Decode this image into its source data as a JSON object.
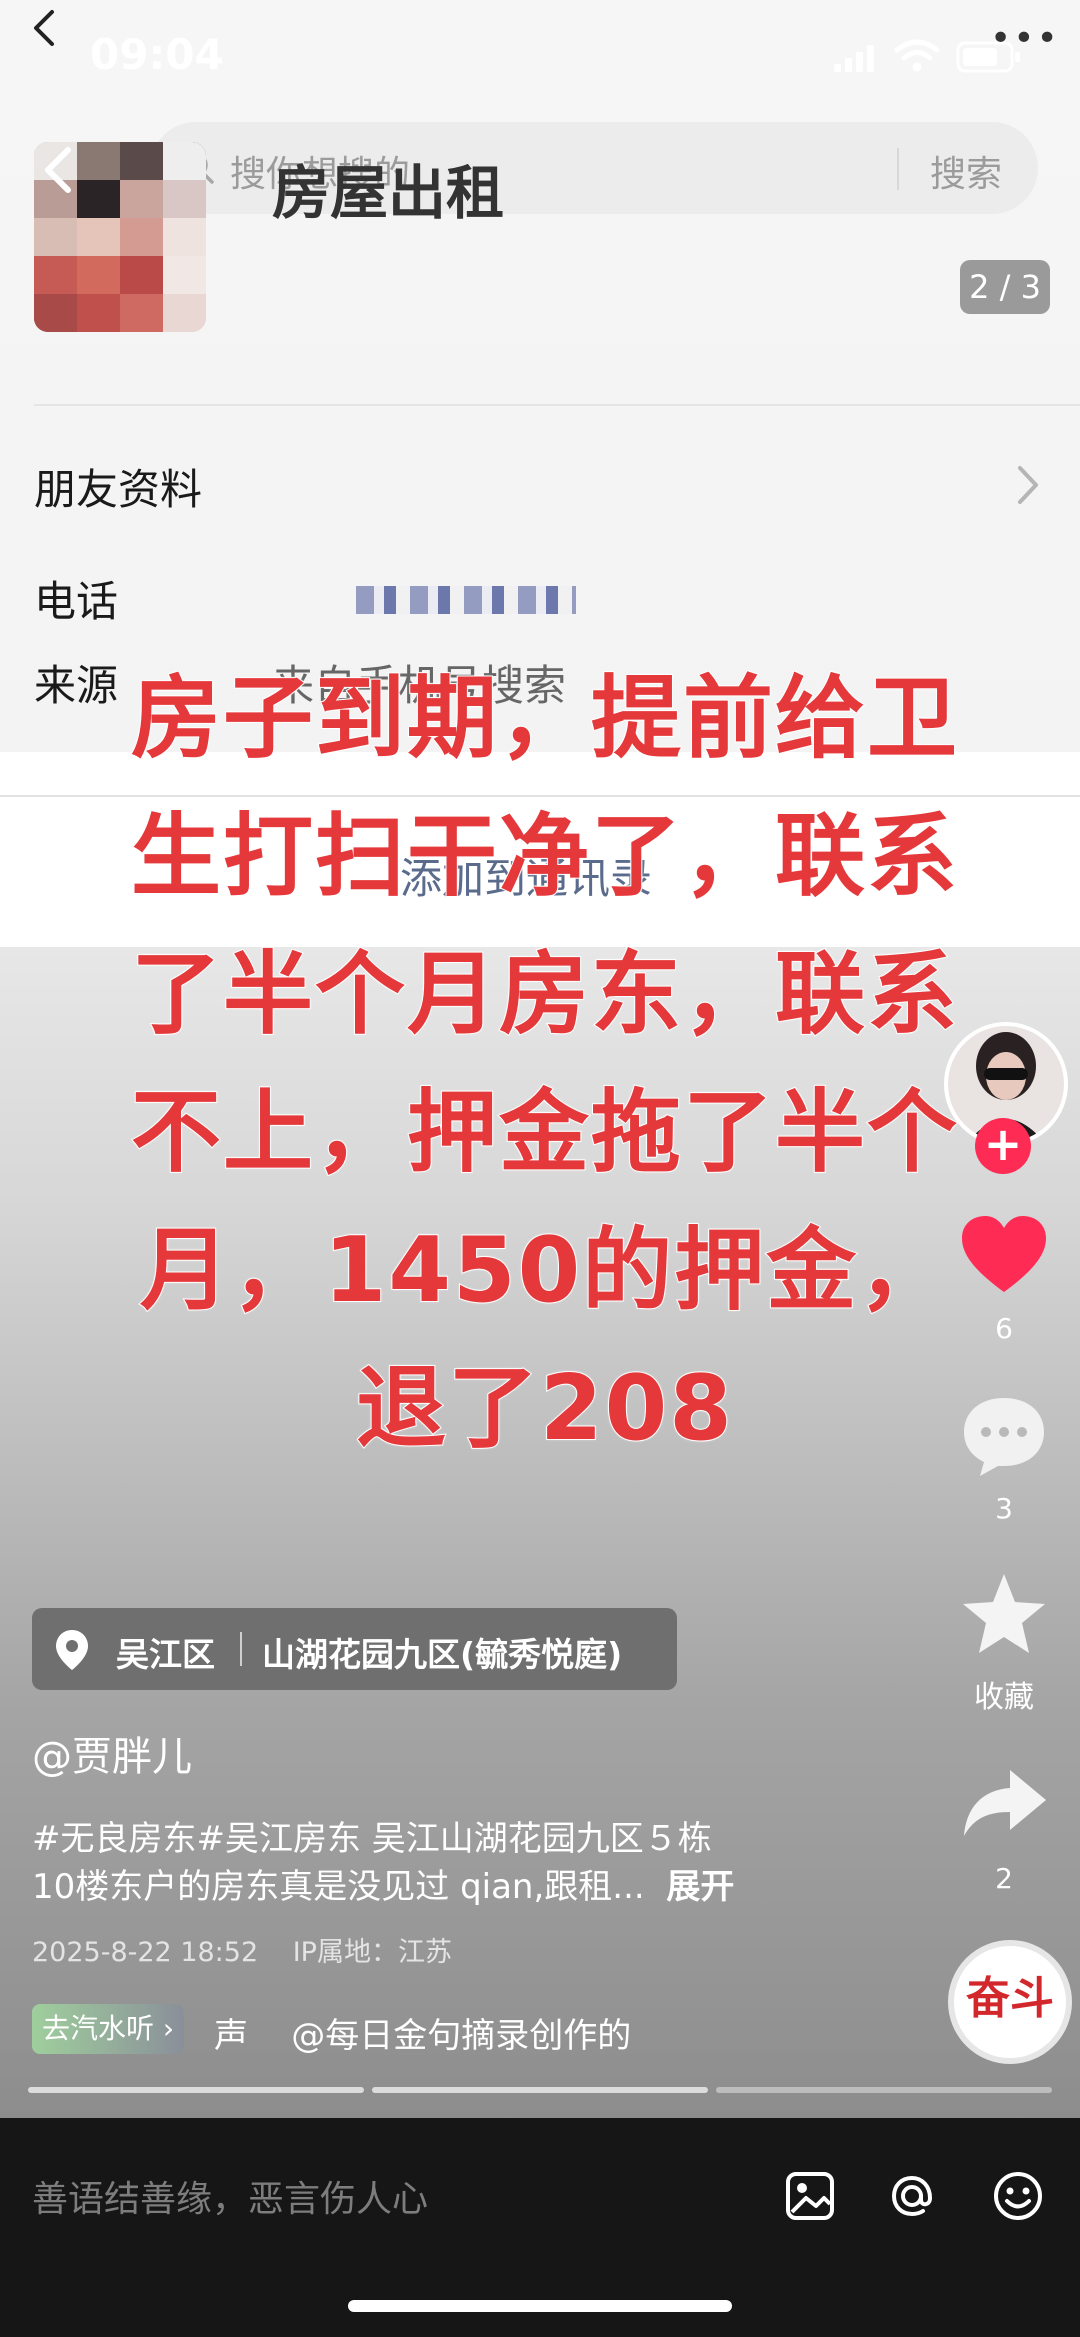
{
  "status_bar": {
    "time": "09:04"
  },
  "underlying": {
    "search_placeholder": "搜你想搜的",
    "search_button": "搜索",
    "page_title": "房屋出租",
    "page_counter": "2 / 3",
    "friend_info_label": "朋友资料",
    "phone_label": "电话",
    "source_label": "来源",
    "source_value": "来自手机号搜索",
    "add_contact": "添加到通讯录"
  },
  "caption": {
    "lines": [
      "房子到期，提前给卫",
      "生打扫干净了，联系",
      "了半个月房东，联系",
      "不上，押金拖了半个",
      "月，1450的押金，",
      "退了208"
    ]
  },
  "actions": {
    "like_count": "6",
    "comment_count": "3",
    "favorite_label": "收藏",
    "share_count": "2",
    "follow_symbol": "+",
    "music_disc_text": "奋斗"
  },
  "location": {
    "district": "吴江区",
    "place": "山湖花园九区(毓秀悦庭)"
  },
  "author": "@贾胖儿",
  "description": {
    "line1": "#无良房东#吴江房东  吴江山湖花园九区５栋",
    "line2": "10楼东户的房东真是没见过 qian,跟租...",
    "expand": "展开"
  },
  "meta": {
    "date": "2025-8-22 18:52",
    "ip": "IP属地：江苏"
  },
  "music": {
    "qishui_label": "去汽水听",
    "chevron": "›",
    "ticker_left": "声",
    "ticker": "@每日金句摘录创作的"
  },
  "input": {
    "placeholder": "善语结善缘，恶言伤人心"
  },
  "colors": {
    "like_red": "#fe2c55",
    "caption_red": "#e5383b",
    "input_bg": "#161616"
  },
  "icons": [
    "back-icon",
    "more-icon",
    "search-icon",
    "chevron-right-icon",
    "heart-icon",
    "comment-icon",
    "star-icon",
    "share-icon",
    "location-pin-icon",
    "image-icon",
    "at-icon",
    "emoji-icon"
  ]
}
